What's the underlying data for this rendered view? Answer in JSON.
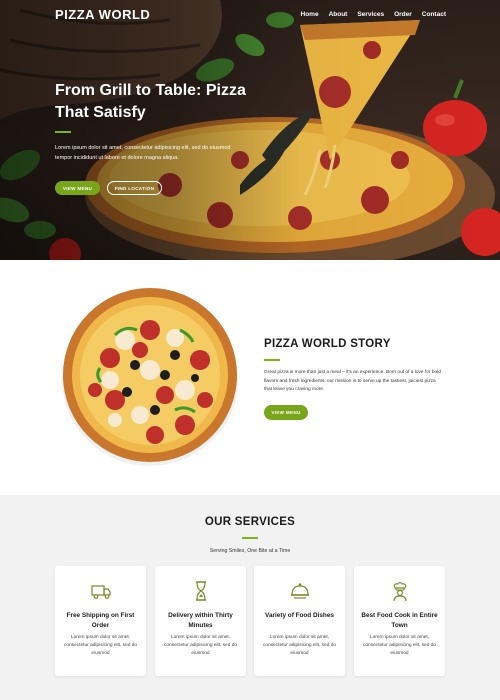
{
  "header": {
    "brand": "PIZZA WORLD",
    "nav": [
      "Home",
      "About",
      "Services",
      "Order",
      "Contact"
    ]
  },
  "hero": {
    "title": "From Grill to Table: Pizza That Satisfy",
    "text": "Lorem ipsum dolor sit amet, consectetur adipisicing elit, sed do eiusmod tempor incididunt ut labore et dolore magna aliqua.",
    "primary_button": "VIEW MENU",
    "secondary_button": "FIND LOCATION"
  },
  "story": {
    "title": "PIZZA WORLD STORY",
    "text": "Great pizza is more than just a meal – it's an experience. Born out of a love for bold flavors and fresh ingredients, our mission is to serve up the tastiest, juiciest pizza that leave you craving more.",
    "button": "VIEW MENU"
  },
  "services": {
    "title": "OUR SERVICES",
    "subtitle": "Serving Smiles, One Bite at a Time",
    "cards": [
      {
        "icon": "delivery-truck-icon",
        "title": "Free Shipping on First Order",
        "text": "Lorem ipsum dolor sit amet, consectetur adipisicing elit, sed do eiusmod"
      },
      {
        "icon": "hourglass-icon",
        "title": "Delivery within Thirty Minutes",
        "text": "Lorem ipsum dolor sit amet, consectetur adipisicing elit, sed do eiusmod"
      },
      {
        "icon": "food-cloche-icon",
        "title": "Variety of Food Dishes",
        "text": "Lorem ipsum dolor sit amet, consectetur adipisicing elit, sed do eiusmod"
      },
      {
        "icon": "chef-icon",
        "title": "Best Food Cook in Entire Town",
        "text": "Lorem ipsum dolor sit amet, consectetur adipisicing elit, sed do eiusmod"
      }
    ]
  },
  "colors": {
    "accent": "#7cb518",
    "button_green": "#78a51a",
    "hero_dark": "#2a1f19",
    "services_bg": "#f2f2f2"
  }
}
